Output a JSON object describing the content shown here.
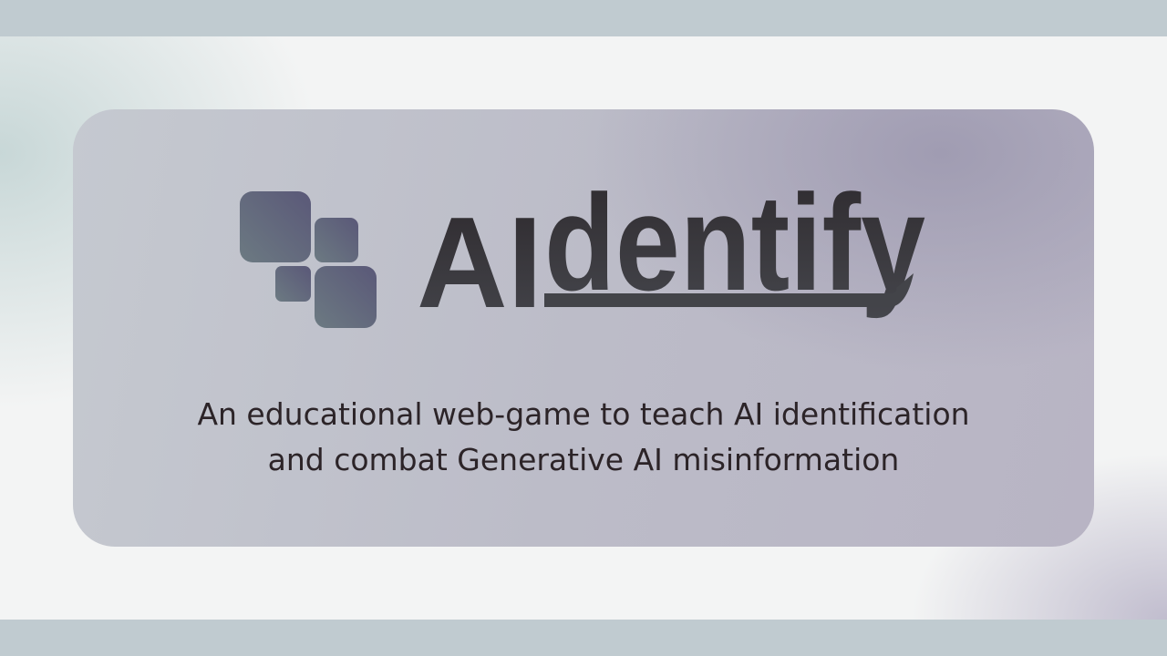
{
  "logo": {
    "text": "AIdentify",
    "part1": "AI",
    "part2": "dentify"
  },
  "tagline": {
    "line1": "An educational web-game to teach AI identification",
    "line2": "and combat Generative AI misinformation"
  },
  "colors": {
    "text": "#2c2428",
    "logo_dark": "#3a383e",
    "tile_purple": "#5a5a78",
    "tile_slate": "#6a7880",
    "band": "#c0cbd0"
  }
}
